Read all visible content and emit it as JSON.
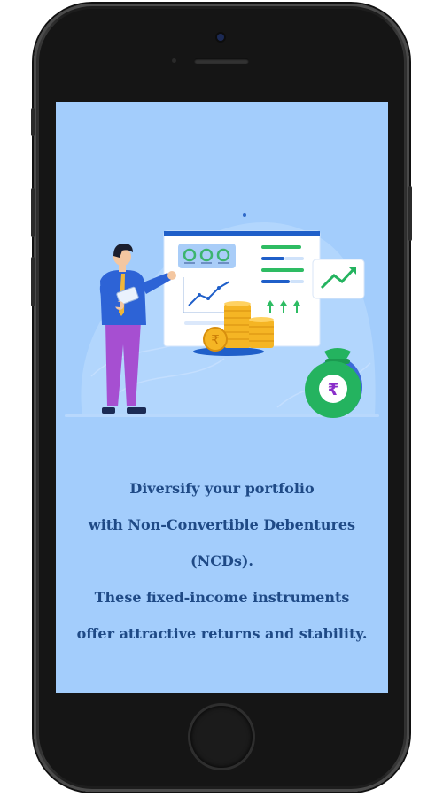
{
  "screen": {
    "background": "#a3cdfc",
    "accent_text_color": "#1f4a86",
    "illustration": {
      "rupee_symbol": "₹",
      "icons": [
        "presenter-illustration",
        "dashboard-board",
        "coin-stack",
        "trend-up-card",
        "money-bag"
      ]
    },
    "message": {
      "line1": "Diversify your portfolio",
      "line2": "with Non-Convertible Debentures (NCDs).",
      "line3": "These fixed-income instruments",
      "line4": "offer attractive returns and stability."
    }
  }
}
